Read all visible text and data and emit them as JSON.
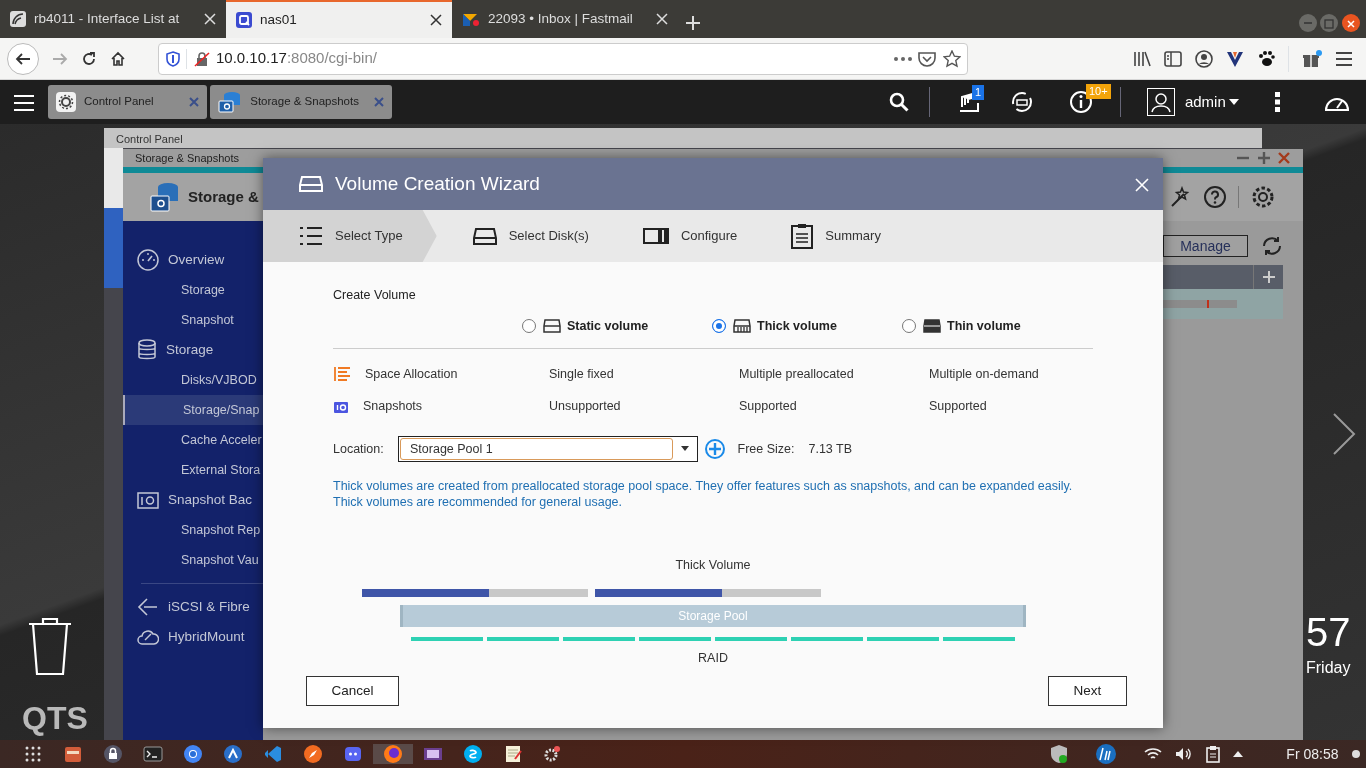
{
  "browser": {
    "tabs": [
      {
        "title": "rb4011 - Interface List at",
        "selected": false
      },
      {
        "title": "nas01",
        "selected": true
      },
      {
        "title": "22093 • Inbox | Fastmail",
        "selected": false
      }
    ],
    "url": {
      "host": "10.0.10.17",
      "path": ":8080/cgi-bin/"
    }
  },
  "qts_bar": {
    "app_tabs": [
      {
        "title": "Control Panel"
      },
      {
        "title": "Storage & Snapshots"
      }
    ],
    "task_badge": "1",
    "notification_badge": "10+",
    "user": "admin"
  },
  "desktop": {
    "control_panel_title": "Control Panel",
    "logo": "QTS",
    "clock": "57",
    "day": "Friday"
  },
  "storage_window": {
    "title": "Storage & Snapshots",
    "header": "Storage &",
    "manage": "Manage",
    "sidebar": [
      {
        "label": "Overview",
        "children": [
          {
            "label": "Storage",
            "selected": false
          },
          {
            "label": "Snapshot",
            "selected": false
          }
        ]
      },
      {
        "label": "Storage",
        "children": [
          {
            "label": "Disks/VJBOD",
            "selected": false
          },
          {
            "label": "Storage/Snap",
            "selected": true
          },
          {
            "label": "Cache Acceler",
            "selected": false
          },
          {
            "label": "External Stora",
            "selected": false
          }
        ]
      },
      {
        "label": "Snapshot Bac",
        "children": [
          {
            "label": "Snapshot Rep",
            "selected": false
          },
          {
            "label": "Snapshot Vau",
            "selected": false
          }
        ]
      },
      {
        "label": "iSCSI & Fibre"
      },
      {
        "label": "HybridMount"
      }
    ]
  },
  "wizard": {
    "title": "Volume Creation Wizard",
    "steps": [
      {
        "label": "Select Type",
        "selected": true
      },
      {
        "label": "Select Disk(s)",
        "selected": false
      },
      {
        "label": "Configure",
        "selected": false
      },
      {
        "label": "Summary",
        "selected": false
      }
    ],
    "heading": "Create Volume",
    "volume_types": [
      {
        "label": "Static volume",
        "selected": false
      },
      {
        "label": "Thick volume",
        "selected": true
      },
      {
        "label": "Thin volume",
        "selected": false
      }
    ],
    "features": [
      {
        "label": "Space Allocation",
        "values": [
          "Single fixed",
          "Multiple preallocated",
          "Multiple on-demand"
        ]
      },
      {
        "label": "Snapshots",
        "values": [
          "Unsupported",
          "Supported",
          "Supported"
        ]
      }
    ],
    "location": {
      "label": "Location:",
      "value": "Storage Pool 1",
      "free_size_label": "Free Size:",
      "free_size": "7.13 TB"
    },
    "description": "Thick volumes are created from preallocated storage pool space. They offer features such as snapshots, and can be expanded easily. Thick volumes are recommended for general usage.",
    "diagram": {
      "volume_label": "Thick Volume",
      "volumes": [
        {
          "level": 0.56
        },
        {
          "level": 0.56
        }
      ],
      "pool_label": "Storage Pool",
      "raid_label": "RAID"
    },
    "buttons": {
      "cancel": "Cancel",
      "next": "Next"
    }
  },
  "taskbar": {
    "clock": "Fr 08:58"
  }
}
